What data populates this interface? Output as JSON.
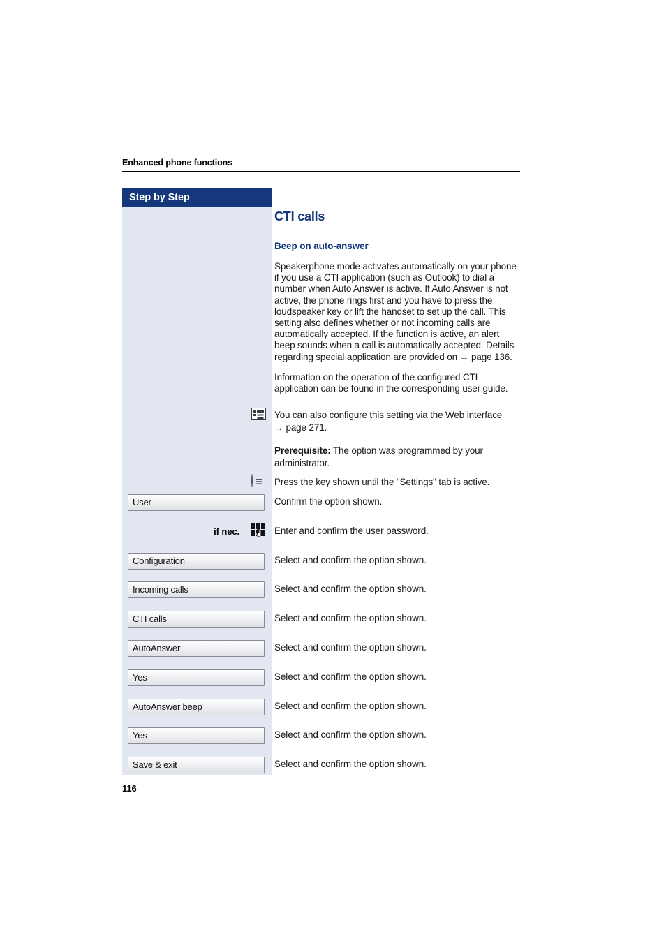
{
  "page": {
    "running_header": "Enhanced phone functions",
    "page_number": "116"
  },
  "sidebar": {
    "header_label": "Step by Step"
  },
  "main": {
    "title": "CTI calls",
    "subtitle": "Beep on auto-answer",
    "paragraph_1": "Speakerphone mode activates automatically on your phone if you use a CTI application (such as Outlook) to dial a number when Auto Answer is active. If Auto Answer is not active, the phone rings first and you have to press the loudspeaker key or lift the handset to set up the call. This setting also defines whether or not incoming calls are automatically accepted. If the function is active, an alert beep sounds when a call is automatically accepted. Details regarding special application are provided on",
    "paragraph_1_arrow": "→",
    "paragraph_1_ref": "page 136.",
    "paragraph_2": "Information on the operation of the configured CTI application can be found in the corresponding user guide.",
    "note_web": "You can also configure this setting via the Web interface",
    "note_web_arrow": "→",
    "note_web_ref": "page 271.",
    "prerequisite_label": "Prerequisite:",
    "prerequisite_text": "The option was programmed by your administrator.",
    "press_key_text": "Press the key shown until the \"Settings\" tab is active."
  },
  "icons": {
    "web_interface": "web-interface-icon",
    "menu_key": "menu-key-icon",
    "keypad": "keypad-icon"
  },
  "steps": [
    {
      "type": "option",
      "label": "User",
      "desc": "Confirm the option shown."
    },
    {
      "type": "keypad",
      "label": "if nec.",
      "desc": "Enter and confirm the user password."
    },
    {
      "type": "option",
      "label": "Configuration",
      "desc": "Select and confirm the option shown."
    },
    {
      "type": "option",
      "label": "Incoming calls",
      "desc": "Select and confirm the option shown."
    },
    {
      "type": "option",
      "label": "CTI calls",
      "desc": "Select and confirm the option shown."
    },
    {
      "type": "option",
      "label": "AutoAnswer",
      "desc": "Select and confirm the option shown."
    },
    {
      "type": "option",
      "label": "Yes",
      "desc": "Select and confirm the option shown."
    },
    {
      "type": "option",
      "label": "AutoAnswer beep",
      "desc": "Select and confirm the option shown."
    },
    {
      "type": "option",
      "label": "Yes",
      "desc": "Select and confirm the option shown."
    },
    {
      "type": "option",
      "label": "Save & exit",
      "desc": "Select and confirm the option shown."
    }
  ],
  "colors": {
    "brand_navy": "#15377c",
    "sidebar_bg": "#e3e7f1",
    "box_border": "#8a8a96"
  }
}
